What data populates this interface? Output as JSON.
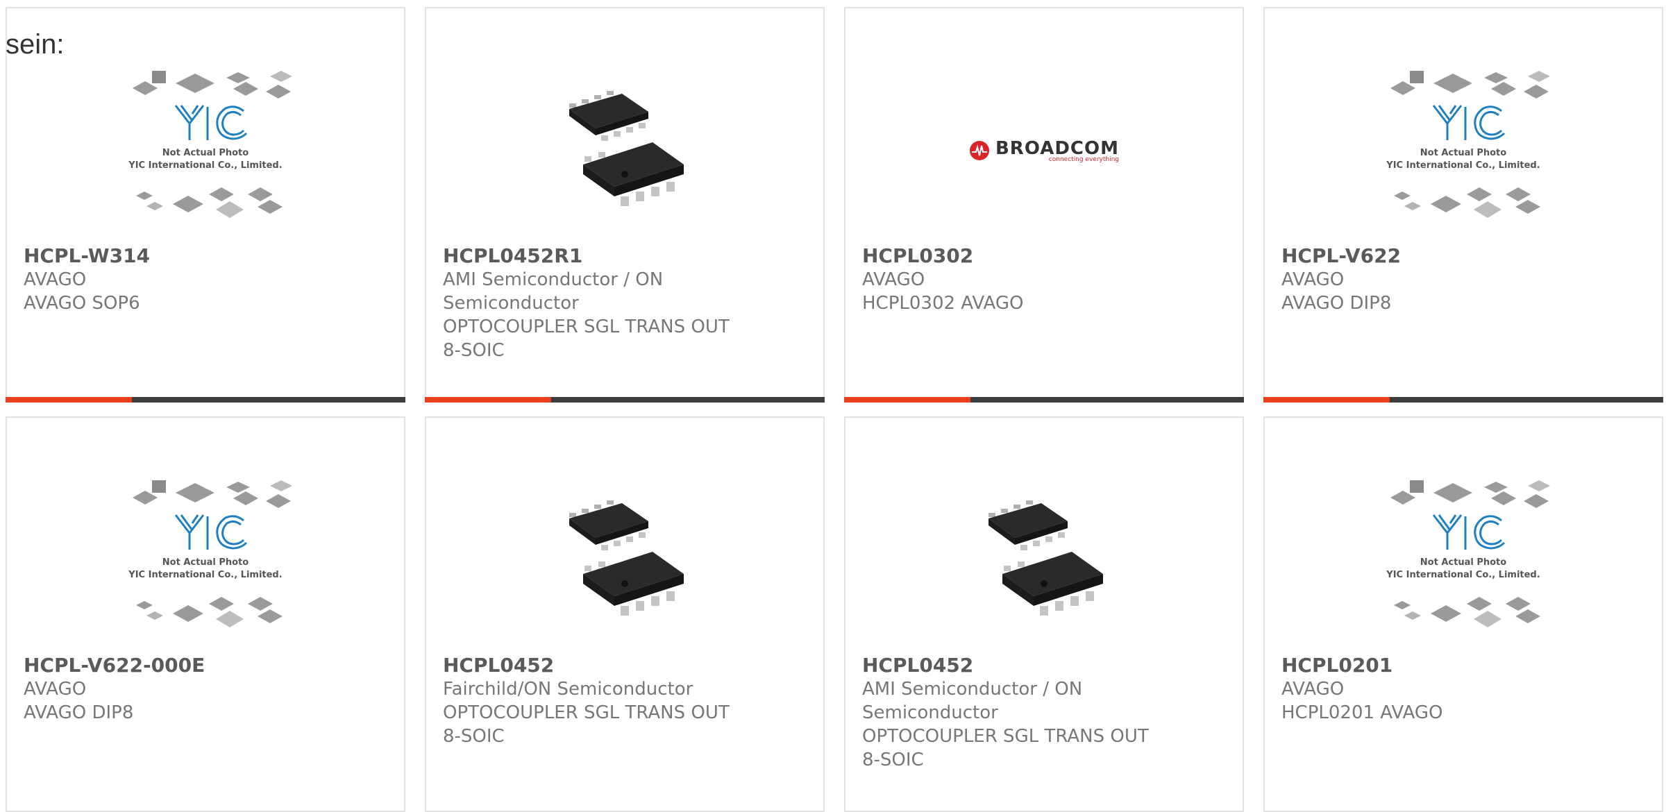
{
  "intro_text": "sein:",
  "colors": {
    "accent": "#e8401c",
    "bar": "#3c3c3c",
    "yic_blue": "#1e7fc1",
    "broadcom_red": "#d9262b"
  },
  "placeholder": {
    "line1": "Not Actual Photo",
    "line2": "YIC International Co., Limited."
  },
  "broadcom": {
    "word": "BROADCOM",
    "tagline": "connecting everything"
  },
  "products": [
    {
      "part": "HCPL-W314",
      "maker": "AVAGO",
      "desc": "AVAGO SOP6",
      "image": "yic-placeholder"
    },
    {
      "part": "HCPL0452R1",
      "maker": "AMI Semiconductor / ON Semiconductor",
      "desc": "OPTOCOUPLER SGL TRANS OUT 8-SOIC",
      "image": "soic-8-chip"
    },
    {
      "part": "HCPL0302",
      "maker": "AVAGO",
      "desc": "HCPL0302 AVAGO",
      "image": "broadcom-logo"
    },
    {
      "part": "HCPL-V622",
      "maker": "AVAGO",
      "desc": "AVAGO DIP8",
      "image": "yic-placeholder"
    },
    {
      "part": "HCPL-V622-000E",
      "maker": "AVAGO",
      "desc": "AVAGO DIP8",
      "image": "yic-placeholder"
    },
    {
      "part": "HCPL0452",
      "maker": "Fairchild/ON Semiconductor",
      "desc": "OPTOCOUPLER SGL TRANS OUT 8-SOIC",
      "image": "soic-8-chip"
    },
    {
      "part": "HCPL0452",
      "maker": "AMI Semiconductor / ON Semiconductor",
      "desc": "OPTOCOUPLER SGL TRANS OUT 8-SOIC",
      "image": "soic-8-chip"
    },
    {
      "part": "HCPL0201",
      "maker": "AVAGO",
      "desc": "HCPL0201 AVAGO",
      "image": "yic-placeholder"
    }
  ]
}
